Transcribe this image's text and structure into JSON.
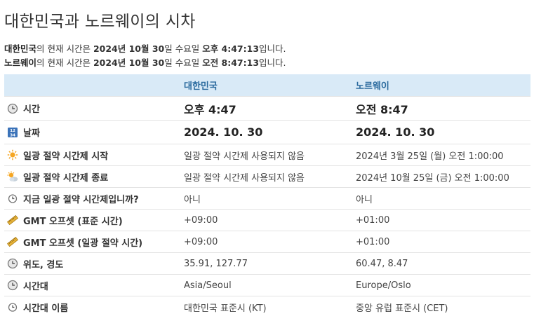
{
  "page": {
    "title": "대한민국과 노르웨이의 시차",
    "summary": [
      {
        "country": "대한민국",
        "mid": "의 현재 시간은 ",
        "date": "2024년 10월 30",
        "mid2": "일 수요일 ",
        "time": "오후 4:47:13",
        "end": "입니다."
      },
      {
        "country": "노르웨이",
        "mid": "의 현재 시간은 ",
        "date": "2024년 10월 30",
        "mid2": "일 수요일 ",
        "time": "오전 8:47:13",
        "end": "입니다."
      }
    ]
  },
  "table": {
    "headers": [
      "",
      "대한민국",
      "노르웨이"
    ],
    "rows": [
      {
        "icon": "clock-icon",
        "label": "시간",
        "a": "오후 4:47",
        "b": "오전 8:47"
      },
      {
        "icon": "calendar-icon",
        "label": "날짜",
        "a": "2024. 10. 30",
        "b": "2024. 10. 30"
      },
      {
        "icon": "sunrise-icon",
        "label": "일광 절약 시간제 시작",
        "a": "일광 절약 시간제 사용되지 않음",
        "b": "2024년 3월 25일 (월) 오전 1:00:00"
      },
      {
        "icon": "cloudy-sun-icon",
        "label": "일광 절약 시간제 종료",
        "a": "일광 절약 시간제 사용되지 않음",
        "b": "2024년 10월 25일 (금) 오전 1:00:00"
      },
      {
        "icon": "small-clock-icon",
        "label": "지금 일광 절약 시간제입니까?",
        "a": "아니",
        "b": "아니"
      },
      {
        "icon": "ruler-icon",
        "label": "GMT 오프셋 (표준 시간)",
        "a": "+09:00",
        "b": "+01:00"
      },
      {
        "icon": "ruler-icon",
        "label": "GMT 오프셋 (일광 절약 시간)",
        "a": "+09:00",
        "b": "+01:00"
      },
      {
        "icon": "clock-icon",
        "label": "위도, 경도",
        "a": "35.91, 127.77",
        "b": "60.47, 8.47"
      },
      {
        "icon": "clock-icon",
        "label": "시간대",
        "a": "Asia/Seoul",
        "b": "Europe/Oslo"
      },
      {
        "icon": "small-clock-icon",
        "label": "시간대 이름",
        "a": "대한민국 표준시 (KT)",
        "b": "중앙 유럽 표준시 (CET)"
      }
    ]
  }
}
